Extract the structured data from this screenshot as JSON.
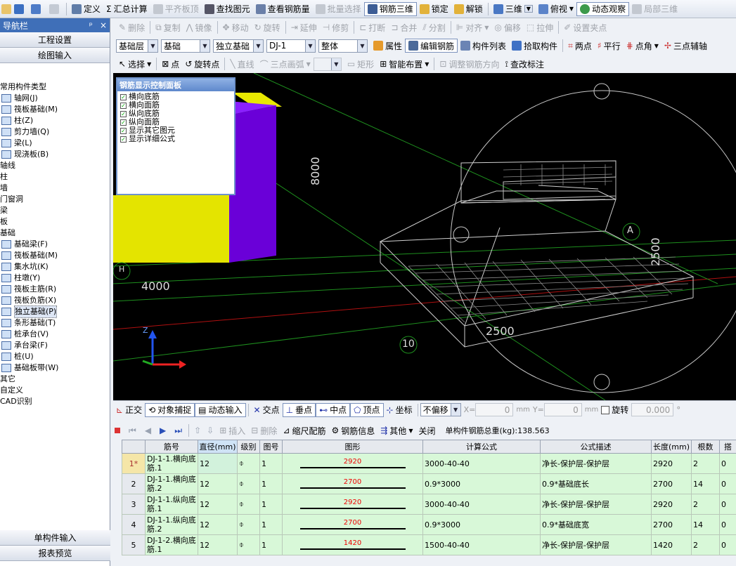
{
  "toolbar1": {
    "items": [
      "定义",
      "汇总计算",
      "平齐板顶",
      "查找图元",
      "查看钢筋量",
      "批量选择",
      "钢筋三维",
      "锁定",
      "解锁",
      "三维",
      "俯视",
      "动态观察",
      "局部三维"
    ]
  },
  "toolbar2": {
    "items": [
      "删除",
      "复制",
      "镜像",
      "移动",
      "旋转",
      "延伸",
      "修剪",
      "打断",
      "合并",
      "分割",
      "对齐",
      "偏移",
      "拉伸",
      "设置夹点"
    ]
  },
  "toolbar3": {
    "selects": [
      "基础层",
      "基础",
      "独立基础",
      "DJ-1",
      "整体"
    ],
    "items": [
      "属性",
      "编辑钢筋",
      "构件列表",
      "拾取构件",
      "两点",
      "平行",
      "点角",
      "三点辅轴"
    ]
  },
  "toolbar4": {
    "items": [
      "选择",
      "点",
      "旋转点",
      "直线",
      "三点画弧",
      "矩形",
      "智能布置",
      "调整钢筋方向",
      "查改标注"
    ]
  },
  "left": {
    "title": "导航栏",
    "pin": "ᵖ",
    "close": "×",
    "btn_project": "工程设置",
    "btn_draw": "绘图输入",
    "tree": [
      {
        "label": "常用构件类型",
        "sub": false
      },
      {
        "label": "轴网(J)",
        "sub": true
      },
      {
        "label": "筏板基础(M)",
        "sub": true
      },
      {
        "label": "柱(Z)",
        "sub": true
      },
      {
        "label": "剪力墙(Q)",
        "sub": true
      },
      {
        "label": "梁(L)",
        "sub": true
      },
      {
        "label": "现浇板(B)",
        "sub": true
      },
      {
        "label": "轴线",
        "sub": false
      },
      {
        "label": "柱",
        "sub": false
      },
      {
        "label": "墙",
        "sub": false
      },
      {
        "label": "门窗洞",
        "sub": false
      },
      {
        "label": "梁",
        "sub": false
      },
      {
        "label": "板",
        "sub": false
      },
      {
        "label": "基础",
        "sub": false
      },
      {
        "label": "基础梁(F)",
        "sub": true
      },
      {
        "label": "筏板基础(M)",
        "sub": true
      },
      {
        "label": "集水坑(K)",
        "sub": true
      },
      {
        "label": "柱墩(Y)",
        "sub": true
      },
      {
        "label": "筏板主筋(R)",
        "sub": true
      },
      {
        "label": "筏板负筋(X)",
        "sub": true
      },
      {
        "label": "独立基础(P)",
        "sub": true,
        "selected": true
      },
      {
        "label": "条形基础(T)",
        "sub": true
      },
      {
        "label": "桩承台(V)",
        "sub": true
      },
      {
        "label": "承台梁(F)",
        "sub": true
      },
      {
        "label": "桩(U)",
        "sub": true
      },
      {
        "label": "基础板带(W)",
        "sub": true
      },
      {
        "label": "其它",
        "sub": false
      },
      {
        "label": "自定义",
        "sub": false
      },
      {
        "label": "CAD识别",
        "sub": false
      }
    ],
    "btn_single": "单构件输入",
    "btn_report": "报表预览"
  },
  "panel": {
    "title": "钢筋显示控制面板",
    "options": [
      "横向底筋",
      "横向面筋",
      "纵向底筋",
      "纵向面筋",
      "显示其它图元",
      "显示详细公式"
    ]
  },
  "view": {
    "dim_8000": "8000",
    "dim_4000": "4000",
    "dim_2500_bottom": "2500",
    "dim_2500_side": "2500",
    "axis_10": "10",
    "axis_A": "A",
    "axis_H": "H",
    "axis_z": "Z"
  },
  "snap": {
    "items": [
      "正交",
      "对象捕捉",
      "动态输入",
      "交点",
      "垂点",
      "中点",
      "顶点",
      "坐标"
    ],
    "offset": "不偏移",
    "x_label": "X=",
    "x_val": "0",
    "y_label": "Y=",
    "y_val": "0",
    "unit": "mm",
    "rotate": "旋转",
    "rotate_val": "0.000",
    "deg": "°"
  },
  "nav": {
    "items": [
      "插入",
      "删除",
      "缩尺配筋",
      "钢筋信息",
      "其他",
      "关闭"
    ],
    "total_label": "单构件钢筋总重(kg):",
    "total": "138.563"
  },
  "grid": {
    "headers": [
      "",
      "筋号",
      "直径(mm)",
      "级别",
      "图号",
      "图形",
      "计算公式",
      "公式描述",
      "长度(mm)",
      "根数",
      "搭"
    ],
    "rows": [
      {
        "idx": "1*",
        "name": "DJ-1-1.横向底筋.1",
        "dia": "12",
        "grade": "⌽",
        "fig": "1",
        "val": "2920",
        "formula": "3000-40-40",
        "desc": "净长-保护层-保护层",
        "len": "2920",
        "cnt": "2",
        "lap": "0"
      },
      {
        "idx": "2",
        "name": "DJ-1-1.横向底筋.2",
        "dia": "12",
        "grade": "⌽",
        "fig": "1",
        "val": "2700",
        "formula": "0.9*3000",
        "desc": "0.9*基础底长",
        "len": "2700",
        "cnt": "14",
        "lap": "0"
      },
      {
        "idx": "3",
        "name": "DJ-1-1.纵向底筋.1",
        "dia": "12",
        "grade": "⌽",
        "fig": "1",
        "val": "2920",
        "formula": "3000-40-40",
        "desc": "净长-保护层-保护层",
        "len": "2920",
        "cnt": "2",
        "lap": "0"
      },
      {
        "idx": "4",
        "name": "DJ-1-1.纵向底筋.2",
        "dia": "12",
        "grade": "⌽",
        "fig": "1",
        "val": "2700",
        "formula": "0.9*3000",
        "desc": "0.9*基础底宽",
        "len": "2700",
        "cnt": "14",
        "lap": "0"
      },
      {
        "idx": "5",
        "name": "DJ-1-2.横向底筋.1",
        "dia": "12",
        "grade": "⌽",
        "fig": "1",
        "val": "1420",
        "formula": "1500-40-40",
        "desc": "净长-保护层-保护层",
        "len": "1420",
        "cnt": "2",
        "lap": "0"
      }
    ]
  }
}
